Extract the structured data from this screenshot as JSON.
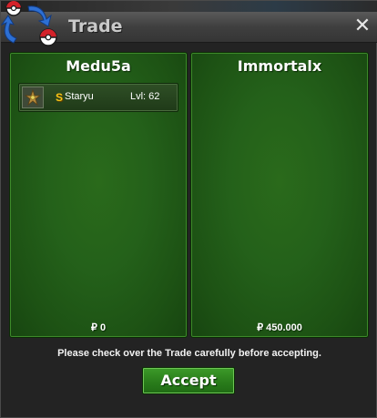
{
  "window": {
    "title": "Trade",
    "close_label": "✕"
  },
  "left_panel": {
    "player_name": "Medu5a",
    "money": "₽ 0",
    "items": [
      {
        "shiny_marker": "S",
        "name": "Staryu",
        "level": "Lvl: 62",
        "icon": "staryu-icon"
      }
    ]
  },
  "right_panel": {
    "player_name": "Immortalx",
    "money": "₽ 450.000",
    "items": []
  },
  "notice": "Please check over the Trade carefully before accepting.",
  "accept_label": "Accept",
  "colors": {
    "panel_green": "#24611a",
    "accept_green": "#2a7d1b",
    "titlebar": "#3f3f3f",
    "shiny_gold": "#f6c417"
  }
}
